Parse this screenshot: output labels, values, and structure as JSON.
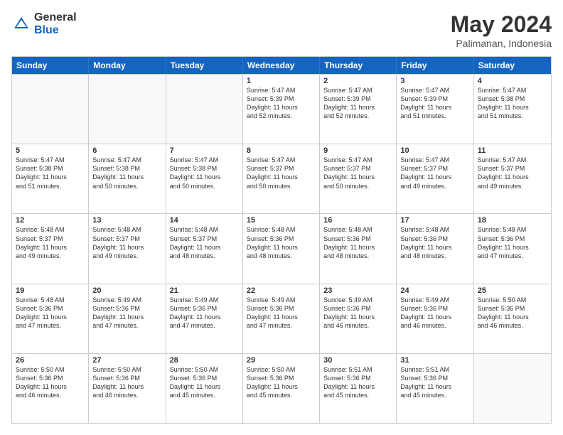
{
  "logo": {
    "general": "General",
    "blue": "Blue"
  },
  "title": "May 2024",
  "subtitle": "Palimanan, Indonesia",
  "header_days": [
    "Sunday",
    "Monday",
    "Tuesday",
    "Wednesday",
    "Thursday",
    "Friday",
    "Saturday"
  ],
  "weeks": [
    [
      {
        "day": "",
        "info": ""
      },
      {
        "day": "",
        "info": ""
      },
      {
        "day": "",
        "info": ""
      },
      {
        "day": "1",
        "info": "Sunrise: 5:47 AM\nSunset: 5:39 PM\nDaylight: 11 hours\nand 52 minutes."
      },
      {
        "day": "2",
        "info": "Sunrise: 5:47 AM\nSunset: 5:39 PM\nDaylight: 11 hours\nand 52 minutes."
      },
      {
        "day": "3",
        "info": "Sunrise: 5:47 AM\nSunset: 5:39 PM\nDaylight: 11 hours\nand 51 minutes."
      },
      {
        "day": "4",
        "info": "Sunrise: 5:47 AM\nSunset: 5:38 PM\nDaylight: 11 hours\nand 51 minutes."
      }
    ],
    [
      {
        "day": "5",
        "info": "Sunrise: 5:47 AM\nSunset: 5:38 PM\nDaylight: 11 hours\nand 51 minutes."
      },
      {
        "day": "6",
        "info": "Sunrise: 5:47 AM\nSunset: 5:38 PM\nDaylight: 11 hours\nand 50 minutes."
      },
      {
        "day": "7",
        "info": "Sunrise: 5:47 AM\nSunset: 5:38 PM\nDaylight: 11 hours\nand 50 minutes."
      },
      {
        "day": "8",
        "info": "Sunrise: 5:47 AM\nSunset: 5:37 PM\nDaylight: 11 hours\nand 50 minutes."
      },
      {
        "day": "9",
        "info": "Sunrise: 5:47 AM\nSunset: 5:37 PM\nDaylight: 11 hours\nand 50 minutes."
      },
      {
        "day": "10",
        "info": "Sunrise: 5:47 AM\nSunset: 5:37 PM\nDaylight: 11 hours\nand 49 minutes."
      },
      {
        "day": "11",
        "info": "Sunrise: 5:47 AM\nSunset: 5:37 PM\nDaylight: 11 hours\nand 49 minutes."
      }
    ],
    [
      {
        "day": "12",
        "info": "Sunrise: 5:48 AM\nSunset: 5:37 PM\nDaylight: 11 hours\nand 49 minutes."
      },
      {
        "day": "13",
        "info": "Sunrise: 5:48 AM\nSunset: 5:37 PM\nDaylight: 11 hours\nand 49 minutes."
      },
      {
        "day": "14",
        "info": "Sunrise: 5:48 AM\nSunset: 5:37 PM\nDaylight: 11 hours\nand 48 minutes."
      },
      {
        "day": "15",
        "info": "Sunrise: 5:48 AM\nSunset: 5:36 PM\nDaylight: 11 hours\nand 48 minutes."
      },
      {
        "day": "16",
        "info": "Sunrise: 5:48 AM\nSunset: 5:36 PM\nDaylight: 11 hours\nand 48 minutes."
      },
      {
        "day": "17",
        "info": "Sunrise: 5:48 AM\nSunset: 5:36 PM\nDaylight: 11 hours\nand 48 minutes."
      },
      {
        "day": "18",
        "info": "Sunrise: 5:48 AM\nSunset: 5:36 PM\nDaylight: 11 hours\nand 47 minutes."
      }
    ],
    [
      {
        "day": "19",
        "info": "Sunrise: 5:48 AM\nSunset: 5:36 PM\nDaylight: 11 hours\nand 47 minutes."
      },
      {
        "day": "20",
        "info": "Sunrise: 5:49 AM\nSunset: 5:36 PM\nDaylight: 11 hours\nand 47 minutes."
      },
      {
        "day": "21",
        "info": "Sunrise: 5:49 AM\nSunset: 5:36 PM\nDaylight: 11 hours\nand 47 minutes."
      },
      {
        "day": "22",
        "info": "Sunrise: 5:49 AM\nSunset: 5:36 PM\nDaylight: 11 hours\nand 47 minutes."
      },
      {
        "day": "23",
        "info": "Sunrise: 5:49 AM\nSunset: 5:36 PM\nDaylight: 11 hours\nand 46 minutes."
      },
      {
        "day": "24",
        "info": "Sunrise: 5:49 AM\nSunset: 5:36 PM\nDaylight: 11 hours\nand 46 minutes."
      },
      {
        "day": "25",
        "info": "Sunrise: 5:50 AM\nSunset: 5:36 PM\nDaylight: 11 hours\nand 46 minutes."
      }
    ],
    [
      {
        "day": "26",
        "info": "Sunrise: 5:50 AM\nSunset: 5:36 PM\nDaylight: 11 hours\nand 46 minutes."
      },
      {
        "day": "27",
        "info": "Sunrise: 5:50 AM\nSunset: 5:36 PM\nDaylight: 11 hours\nand 46 minutes."
      },
      {
        "day": "28",
        "info": "Sunrise: 5:50 AM\nSunset: 5:36 PM\nDaylight: 11 hours\nand 45 minutes."
      },
      {
        "day": "29",
        "info": "Sunrise: 5:50 AM\nSunset: 5:36 PM\nDaylight: 11 hours\nand 45 minutes."
      },
      {
        "day": "30",
        "info": "Sunrise: 5:51 AM\nSunset: 5:36 PM\nDaylight: 11 hours\nand 45 minutes."
      },
      {
        "day": "31",
        "info": "Sunrise: 5:51 AM\nSunset: 5:36 PM\nDaylight: 11 hours\nand 45 minutes."
      },
      {
        "day": "",
        "info": ""
      }
    ]
  ]
}
